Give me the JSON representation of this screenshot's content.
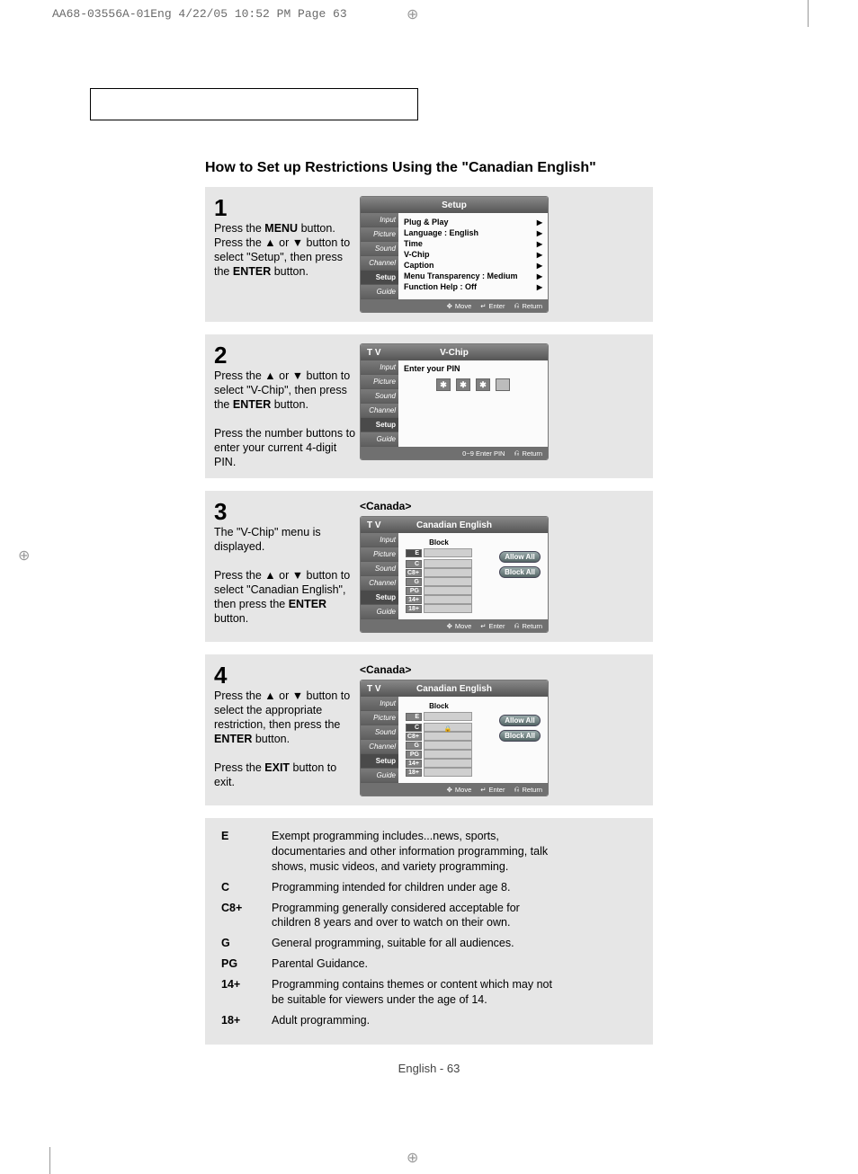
{
  "crop": {
    "header": "AA68-03556A-01Eng  4/22/05  10:52 PM  Page 63"
  },
  "heading": "How to Set up Restrictions Using the \"Canadian English\"",
  "nav_arrow": "◀",
  "steps": [
    {
      "num": "1",
      "text_parts": [
        "Press the ",
        "MENU",
        " button. Press the ▲ or ▼ button to select \"Setup\", then press the ",
        "ENTER",
        " button."
      ],
      "tv": {
        "title": "Setup",
        "tv_label": "",
        "tabs": [
          "Input",
          "Picture",
          "Sound",
          "Channel",
          "Setup",
          "Guide"
        ],
        "active_tab": "Setup",
        "body_rows": [
          {
            "l": "Plug & Play",
            "r": "",
            "a": "▶"
          },
          {
            "l": "Language",
            "r": ":   English",
            "a": "▶"
          },
          {
            "l": "Time",
            "r": "",
            "a": "▶"
          },
          {
            "l": "V-Chip",
            "r": "",
            "a": "▶"
          },
          {
            "l": "Caption",
            "r": "",
            "a": "▶"
          },
          {
            "l": "Menu Transparency :",
            "r": "Medium",
            "a": "▶"
          },
          {
            "l": "Function Help",
            "r": ":   Off",
            "a": "▶"
          }
        ],
        "footer": [
          "Move",
          "Enter",
          "Return"
        ]
      }
    },
    {
      "num": "2",
      "text_parts": [
        "Press the ▲ or ▼ button to select \"V-Chip\", then press the ",
        "ENTER",
        " button.\n\nPress the number buttons to enter your current 4-digit PIN."
      ],
      "tv": {
        "title": "V-Chip",
        "tv_label": "T V",
        "tabs": [
          "Input",
          "Picture",
          "Sound",
          "Channel",
          "Setup",
          "Guide"
        ],
        "active_tab": "Setup",
        "pin_label": "Enter your PIN",
        "pin": [
          "✱",
          "✱",
          "✱",
          ""
        ],
        "footer": [
          "0~9  Enter PIN",
          "Return"
        ]
      }
    },
    {
      "num": "3",
      "text_parts": [
        "The \"V-Chip\" menu is displayed.\n\nPress the ▲ or ▼ button to select \"Canadian English\", then press the ",
        "ENTER",
        " button."
      ],
      "tv_caption": "<Canada>",
      "tv": {
        "title": "Canadian English",
        "tv_label": "T V",
        "tabs": [
          "Input",
          "Picture",
          "Sound",
          "Channel",
          "Setup",
          "Guide"
        ],
        "active_tab": "Setup",
        "block_head": "Block",
        "ratings": [
          "E",
          "C",
          "C8+",
          "G",
          "PG",
          "14+",
          "18+"
        ],
        "highlight_row": "E",
        "show_lock_on": null,
        "buttons": [
          "Allow All",
          "Block All"
        ],
        "footer": [
          "Move",
          "Enter",
          "Return"
        ]
      }
    },
    {
      "num": "4",
      "text_parts": [
        "Press the ▲ or ▼ button to select the appropriate restriction, then press  the ",
        "ENTER",
        " button.\n\nPress the ",
        "EXIT",
        " button to exit."
      ],
      "tv_caption": "<Canada>",
      "tv": {
        "title": "Canadian English",
        "tv_label": "T V",
        "tabs": [
          "Input",
          "Picture",
          "Sound",
          "Channel",
          "Setup",
          "Guide"
        ],
        "active_tab": "Setup",
        "block_head": "Block",
        "ratings": [
          "E",
          "C",
          "C8+",
          "G",
          "PG",
          "14+",
          "18+"
        ],
        "highlight_row": "C",
        "show_lock_on": "C",
        "buttons": [
          "Allow All",
          "Block All"
        ],
        "footer": [
          "Move",
          "Enter",
          "Return"
        ]
      }
    }
  ],
  "glossary": [
    {
      "k": "E",
      "v": "Exempt programming includes...news, sports, documentaries and other information programming, talk shows, music videos, and variety programming."
    },
    {
      "k": "C",
      "v": "Programming intended for children under age 8."
    },
    {
      "k": "C8+",
      "v": "Programming generally considered acceptable for children 8 years and over to watch on their own."
    },
    {
      "k": "G",
      "v": "General programming, suitable for all audiences."
    },
    {
      "k": "PG",
      "v": "Parental Guidance."
    },
    {
      "k": "14+",
      "v": "Programming contains themes or content which may not be suitable for viewers under the age of 14."
    },
    {
      "k": "18+",
      "v": "Adult programming."
    }
  ],
  "footer": "English - 63"
}
